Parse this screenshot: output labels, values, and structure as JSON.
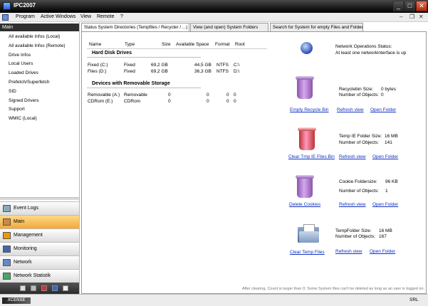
{
  "window": {
    "title": "IPC2007"
  },
  "menu": [
    "Program",
    "Active Windows",
    "View",
    "Remote",
    "?"
  ],
  "sidebar": {
    "header": "Main",
    "items": [
      "All available Infos (Local)",
      "All available Infos (Remote)",
      "Drive Infos",
      "Local Users",
      "Loaded Drives",
      "Prefetch/Superfetch",
      "SID",
      "Signed Drivers",
      "Support",
      "WMIC (Local)"
    ],
    "nav": [
      "Event Logs",
      "Main",
      "Management",
      "Monitoring",
      "Network",
      "Network Statistik"
    ]
  },
  "tabs": [
    "Status System Directories (Tempfiles / Recycler / ...)",
    "View (and open) System Folders",
    "Search for System for empty Files and Folders"
  ],
  "table": {
    "headers": [
      "Name",
      "Type",
      "Size",
      "Available Space",
      "Format",
      "Root"
    ],
    "hdd_section": "Hard Disk Drives",
    "hdd_rows": [
      [
        "Fixed (C:)",
        "Fixed",
        "69,2  GB",
        "44,5  GB",
        "NTFS",
        "C:\\"
      ],
      [
        "Files (D:)",
        "Fixed",
        "69,2  GB",
        "36,3  GB",
        "NTFS",
        "D:\\"
      ]
    ],
    "removable_section": "Devices with Removable Storage",
    "removable_rows": [
      [
        "Removable (A:)",
        "Removable",
        "0",
        "0",
        "0",
        "0"
      ],
      [
        "CDRom (E:)",
        "CDRom",
        "0",
        "0",
        "0",
        "0"
      ]
    ]
  },
  "network": {
    "label": "Network Operations Status:",
    "status": "At least one networkinterface is up"
  },
  "recycle": {
    "size_label": "Recyclebin Size:",
    "size": "0 bytes",
    "count_label": "Number of Objects:",
    "count": "0",
    "action": "Empty Recycle Bin",
    "refresh": "Refresh view",
    "open": "Open Folder"
  },
  "tempie": {
    "size_label": "Temp IE Folder Size:",
    "size": "16 MB",
    "count_label": "Number of Objects:",
    "count": "141",
    "action": "Clear Tmp IE Files Bin",
    "refresh": "Refresh view",
    "open": "Open Folder"
  },
  "cookie": {
    "size_label": "Cookie Foldersize:",
    "size": "96 KB",
    "count_label": "Number of Objects:",
    "count": "1",
    "action": "Delete Cookies",
    "refresh": "Refresh view",
    "open": "Open Folder"
  },
  "temp": {
    "size_label": "TempFolder Size:",
    "size": "16 MB",
    "count_label": "Number of Objects:",
    "count": "167",
    "action": "Clear Temp Files",
    "refresh": "Refresh view",
    "open": "Open Folder"
  },
  "footnote": "After clearing, Count is larger than 0: Some System files can't be deleted as long as an user is logged on.",
  "status": {
    "logo": "XCENSE",
    "right": "SRL"
  }
}
